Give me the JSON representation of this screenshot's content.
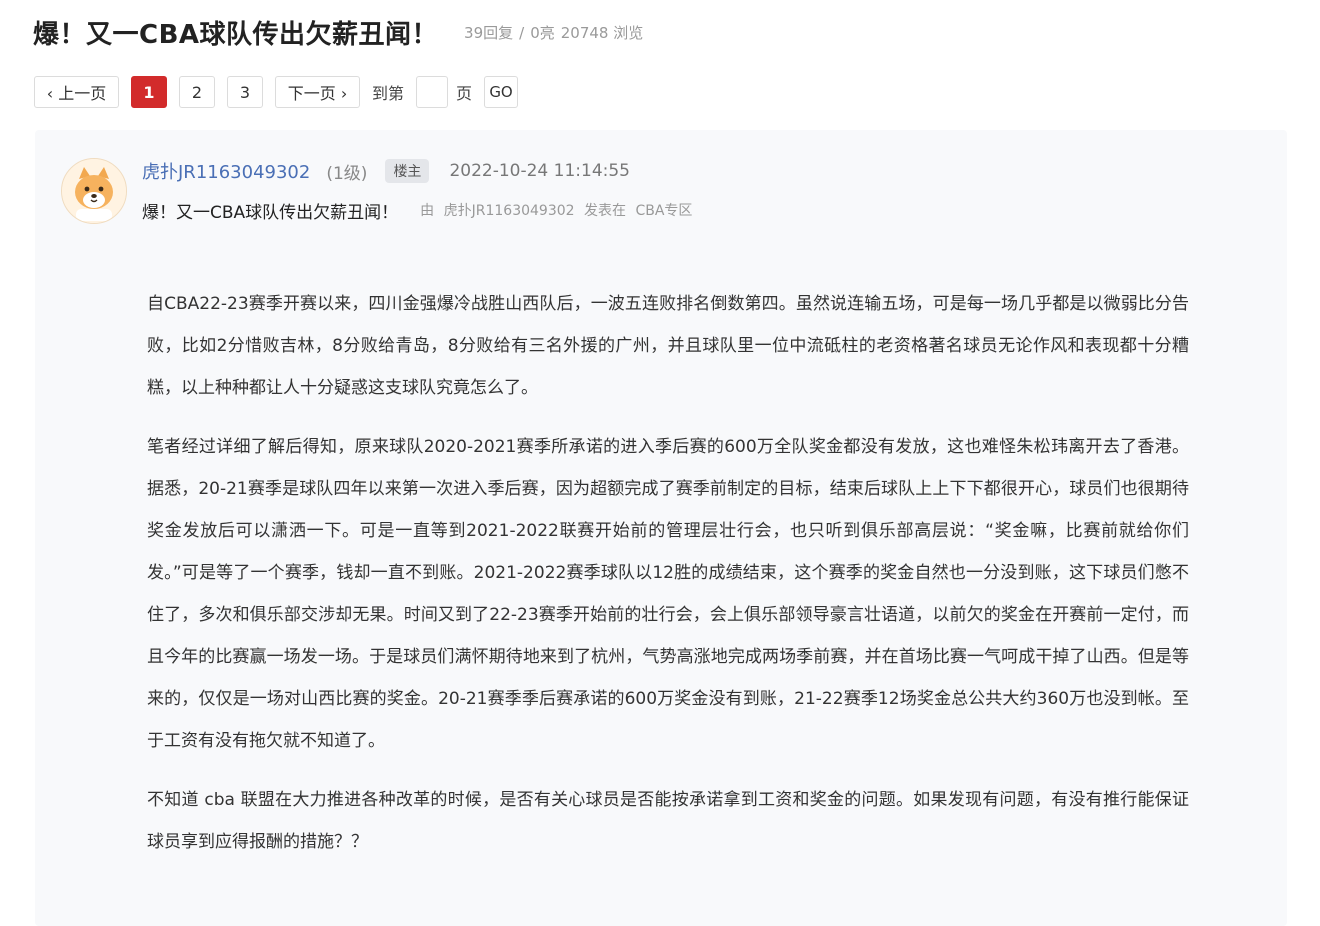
{
  "thread": {
    "title": "爆！又一CBA球队传出欠薪丑闻！",
    "replies": "39回复",
    "separator": "/",
    "likes": "0亮",
    "views": "20748 浏览"
  },
  "pager": {
    "prev_label": "‹ 上一页",
    "pages": [
      "1",
      "2",
      "3"
    ],
    "current_page": "1",
    "next_label": "下一页 ›",
    "goto_label": "到第",
    "page_label": "页",
    "go_label": "GO",
    "input_value": ""
  },
  "post": {
    "avatar_icon": "cartoon-dog-avatar-icon",
    "username": "虎扑JR1163049302",
    "level": "(1级)",
    "op_badge": "楼主",
    "time": "2022-10-24 11:14:55",
    "title": "爆！又一CBA球队传出欠薪丑闻！",
    "origin_by": "由",
    "origin_user": "虎扑JR1163049302",
    "origin_posted": "发表在",
    "origin_forum": "CBA专区",
    "paragraphs": [
      "自CBA22-23赛季开赛以来，四川金强爆冷战胜山西队后，一波五连败排名倒数第四。虽然说连输五场，可是每一场几乎都是以微弱比分告败，比如2分惜败吉林，8分败给青岛，8分败给有三名外援的广州，并且球队里一位中流砥柱的老资格著名球员无论作风和表现都十分糟糕，以上种种都让人十分疑惑这支球队究竟怎么了。",
      "笔者经过详细了解后得知，原来球队2020-2021赛季所承诺的进入季后赛的600万全队奖金都没有发放，这也难怪朱松玮离开去了香港。据悉，20-21赛季是球队四年以来第一次进入季后赛，因为超额完成了赛季前制定的目标，结束后球队上上下下都很开心，球员们也很期待奖金发放后可以潇洒一下。可是一直等到2021-2022联赛开始前的管理层壮行会，也只听到俱乐部高层说：“奖金嘛，比赛前就给你们发。”可是等了一个赛季，钱却一直不到账。2021-2022赛季球队以12胜的成绩结束，这个赛季的奖金自然也一分没到账，这下球员们憋不住了，多次和俱乐部交涉却无果。时间又到了22-23赛季开始前的壮行会，会上俱乐部领导豪言壮语道，以前欠的奖金在开赛前一定付，而且今年的比赛赢一场发一场。于是球员们满怀期待地来到了杭州，气势高涨地完成两场季前赛，并在首场比赛一气呵成干掉了山西。但是等来的，仅仅是一场对山西比赛的奖金。20-21赛季季后赛承诺的600万奖金没有到账，21-22赛季12场奖金总公共大约360万也没到帐。至于工资有没有拖欠就不知道了。",
      "不知道 cba 联盟在大力推进各种改革的时候，是否有关心球员是否能按承诺拿到工资和奖金的问题。如果发现有问题，有没有推行能保证球员享到应得报酬的措施？？"
    ]
  },
  "colors": {
    "accent_red": "#d22b2b",
    "username_blue": "#4a6fb5",
    "card_background": "#f8f9fb"
  }
}
